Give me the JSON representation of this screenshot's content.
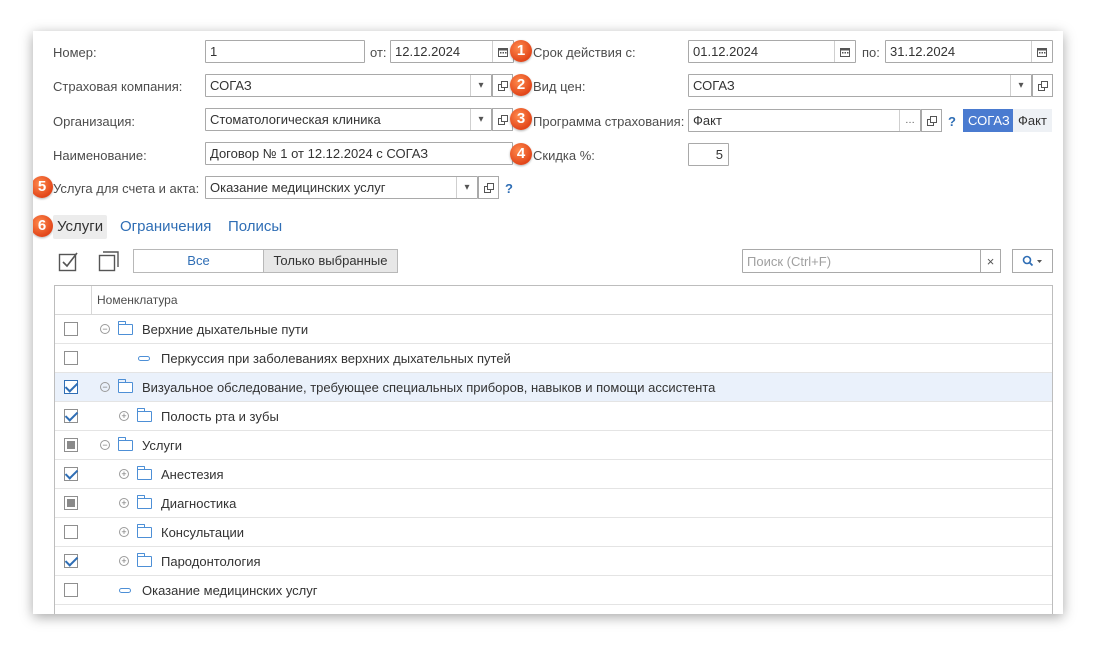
{
  "form": {
    "number_label": "Номер:",
    "number_value": "1",
    "from_label": "от:",
    "date_value": "12.12.2024",
    "validity_label": "Срок действия с:",
    "validity_from": "01.12.2024",
    "to_label": "по:",
    "validity_to": "31.12.2024",
    "insurer_label": "Страховая компания:",
    "insurer_value": "СОГАЗ",
    "price_type_label": "Вид цен:",
    "price_type_value": "СОГАЗ",
    "org_label": "Организация:",
    "org_value": "Стоматологическая клиника",
    "program_label": "Программа страхования:",
    "program_value": "Факт",
    "program_chip_active": "СОГАЗ",
    "program_chip": "Факт",
    "name_label": "Наименование:",
    "name_value": "Договор № 1 от 12.12.2024 с СОГАЗ",
    "discount_label": "Скидка %:",
    "discount_value": "5",
    "service_label": "Услуга для счета и акта:",
    "service_value": "Оказание медицинских услуг",
    "help": "?"
  },
  "badges": [
    "1",
    "2",
    "3",
    "4",
    "5",
    "6"
  ],
  "tabs": [
    "Услуги",
    "Ограничения",
    "Полисы"
  ],
  "toolbar": {
    "filter_all": "Все",
    "filter_selected": "Только выбранные",
    "search_placeholder": "Поиск (Ctrl+F)",
    "clear": "×"
  },
  "table": {
    "header": "Номенклатура",
    "rows": [
      {
        "text": "Верхние дыхательные пути",
        "check": "none"
      },
      {
        "text": "Перкуссия при заболеваниях верхних дыхательных путей",
        "check": "none"
      },
      {
        "text": "Визуальное обследование, требующее специальных приборов, навыков и помощи ассистента",
        "check": "checked"
      },
      {
        "text": "Полость рта и зубы",
        "check": "checked"
      },
      {
        "text": "Услуги",
        "check": "partial"
      },
      {
        "text": "Анестезия",
        "check": "checked"
      },
      {
        "text": "Диагностика",
        "check": "partial"
      },
      {
        "text": "Консультации",
        "check": "none"
      },
      {
        "text": "Пародонтология",
        "check": "checked"
      },
      {
        "text": "Оказание медицинских услуг",
        "check": "none"
      }
    ]
  },
  "icons": {
    "calendar": "calendar-icon",
    "dropdown": "chevron-down-icon",
    "open": "open-icon",
    "check_all": "check-all-icon",
    "uncheck_all": "uncheck-all-icon",
    "search": "search-icon"
  },
  "colors": {
    "accent": "#2f6eb5",
    "badge": "#e2461a",
    "chip_active": "#4a7bd0",
    "row_highlight": "#eaf1fb"
  }
}
